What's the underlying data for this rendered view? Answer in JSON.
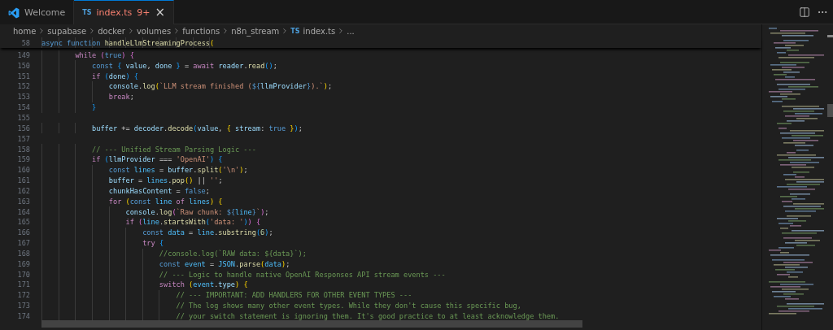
{
  "tabs": [
    {
      "kind": "welcome",
      "label": "Welcome",
      "selected": false
    },
    {
      "kind": "file",
      "file_icon": "TS",
      "label": "index.ts",
      "badge": "9+",
      "has_errors": true,
      "selected": true,
      "close": "×"
    }
  ],
  "breadcrumbs": [
    {
      "kind": "folder",
      "label": "home"
    },
    {
      "kind": "folder",
      "label": "supabase"
    },
    {
      "kind": "folder",
      "label": "docker"
    },
    {
      "kind": "folder",
      "label": "volumes"
    },
    {
      "kind": "folder",
      "label": "functions"
    },
    {
      "kind": "folder",
      "label": "n8n_stream"
    },
    {
      "kind": "file",
      "file_icon": "TS",
      "label": "index.ts"
    },
    {
      "kind": "more",
      "label": "..."
    }
  ],
  "sticky_line": {
    "number": "58",
    "code": [
      {
        "t": "async",
        "kind": "kw"
      },
      {
        "t": " function",
        "kind": "kw"
      },
      {
        "t": " handleLlmStreamingProcess",
        "kind": "fn"
      },
      {
        "t": "(",
        "kind": "b1"
      }
    ]
  },
  "lines": [
    {
      "number": "149",
      "code": [
        {
          "t": "        while",
          "kind": "ctl"
        },
        {
          "t": " (",
          "kind": "b2"
        },
        {
          "t": "true",
          "kind": "kw"
        },
        {
          "t": ")",
          "kind": "b2"
        },
        {
          "t": " {",
          "kind": "b2"
        }
      ]
    },
    {
      "number": "150",
      "code": [
        {
          "t": "            const",
          "kind": "kw"
        },
        {
          "t": " {",
          "kind": "b3"
        },
        {
          "t": " value",
          "kind": "var"
        },
        {
          "t": ", ",
          "kind": "p"
        },
        {
          "t": "done",
          "kind": "var"
        },
        {
          "t": " }",
          "kind": "b3"
        },
        {
          "t": " = ",
          "kind": "p"
        },
        {
          "t": "await",
          "kind": "ctl"
        },
        {
          "t": " reader",
          "kind": "var"
        },
        {
          "t": ".",
          "kind": "p"
        },
        {
          "t": "read",
          "kind": "fn"
        },
        {
          "t": "()",
          "kind": "b3"
        },
        {
          "t": ";",
          "kind": "p"
        }
      ]
    },
    {
      "number": "151",
      "code": [
        {
          "t": "            if",
          "kind": "ctl"
        },
        {
          "t": " (",
          "kind": "b3"
        },
        {
          "t": "done",
          "kind": "var"
        },
        {
          "t": ")",
          "kind": "b3"
        },
        {
          "t": " {",
          "kind": "b3"
        }
      ]
    },
    {
      "number": "152",
      "code": [
        {
          "t": "                console",
          "kind": "var"
        },
        {
          "t": ".",
          "kind": "p"
        },
        {
          "t": "log",
          "kind": "fn"
        },
        {
          "t": "(",
          "kind": "b1"
        },
        {
          "t": "`LLM stream finished (",
          "kind": "str"
        },
        {
          "t": "${",
          "kind": "kw"
        },
        {
          "t": "llmProvider",
          "kind": "var"
        },
        {
          "t": "}",
          "kind": "kw"
        },
        {
          "t": ").`",
          "kind": "str"
        },
        {
          "t": ")",
          "kind": "b1"
        },
        {
          "t": ";",
          "kind": "p"
        }
      ]
    },
    {
      "number": "153",
      "code": [
        {
          "t": "                break",
          "kind": "ctl"
        },
        {
          "t": ";",
          "kind": "p"
        }
      ]
    },
    {
      "number": "154",
      "code": [
        {
          "t": "            }",
          "kind": "b3"
        }
      ]
    },
    {
      "number": "155"
    },
    {
      "number": "156",
      "code": [
        {
          "t": "            buffer",
          "kind": "var"
        },
        {
          "t": " += ",
          "kind": "p"
        },
        {
          "t": "decoder",
          "kind": "var"
        },
        {
          "t": ".",
          "kind": "p"
        },
        {
          "t": "decode",
          "kind": "fn"
        },
        {
          "t": "(",
          "kind": "b3"
        },
        {
          "t": "value",
          "kind": "var"
        },
        {
          "t": ", ",
          "kind": "p"
        },
        {
          "t": "{",
          "kind": "b1"
        },
        {
          "t": " stream",
          "kind": "var"
        },
        {
          "t": ": ",
          "kind": "p"
        },
        {
          "t": "true",
          "kind": "kw"
        },
        {
          "t": " }",
          "kind": "b1"
        },
        {
          "t": ")",
          "kind": "b3"
        },
        {
          "t": ";",
          "kind": "p"
        }
      ]
    },
    {
      "number": "157"
    },
    {
      "number": "158",
      "code": [
        {
          "t": "            // --- Unified Stream Parsing Logic ---",
          "kind": "cmt"
        }
      ]
    },
    {
      "number": "159",
      "code": [
        {
          "t": "            if",
          "kind": "ctl"
        },
        {
          "t": " (",
          "kind": "b3"
        },
        {
          "t": "llmProvider",
          "kind": "var"
        },
        {
          "t": " === ",
          "kind": "p"
        },
        {
          "t": "'OpenAI'",
          "kind": "str"
        },
        {
          "t": ")",
          "kind": "b3"
        },
        {
          "t": " {",
          "kind": "b3"
        }
      ]
    },
    {
      "number": "160",
      "code": [
        {
          "t": "                const",
          "kind": "kw"
        },
        {
          "t": " lines",
          "kind": "const"
        },
        {
          "t": " = ",
          "kind": "p"
        },
        {
          "t": "buffer",
          "kind": "var"
        },
        {
          "t": ".",
          "kind": "p"
        },
        {
          "t": "split",
          "kind": "fn"
        },
        {
          "t": "(",
          "kind": "b1"
        },
        {
          "t": "'\\n'",
          "kind": "str"
        },
        {
          "t": ")",
          "kind": "b1"
        },
        {
          "t": ";",
          "kind": "p"
        }
      ]
    },
    {
      "number": "161",
      "code": [
        {
          "t": "                buffer",
          "kind": "var"
        },
        {
          "t": " = ",
          "kind": "p"
        },
        {
          "t": "lines",
          "kind": "const"
        },
        {
          "t": ".",
          "kind": "p"
        },
        {
          "t": "pop",
          "kind": "fn"
        },
        {
          "t": "()",
          "kind": "b1"
        },
        {
          "t": " || ",
          "kind": "p"
        },
        {
          "t": "''",
          "kind": "str"
        },
        {
          "t": ";",
          "kind": "p"
        }
      ]
    },
    {
      "number": "162",
      "code": [
        {
          "t": "                chunkHasContent",
          "kind": "var"
        },
        {
          "t": " = ",
          "kind": "p"
        },
        {
          "t": "false",
          "kind": "kw"
        },
        {
          "t": ";",
          "kind": "p"
        }
      ]
    },
    {
      "number": "163",
      "code": [
        {
          "t": "                for",
          "kind": "ctl"
        },
        {
          "t": " (",
          "kind": "b1"
        },
        {
          "t": "const",
          "kind": "kw"
        },
        {
          "t": " line",
          "kind": "const"
        },
        {
          "t": " of ",
          "kind": "ctl"
        },
        {
          "t": "lines",
          "kind": "const"
        },
        {
          "t": ")",
          "kind": "b1"
        },
        {
          "t": " {",
          "kind": "b1"
        }
      ]
    },
    {
      "number": "164",
      "code": [
        {
          "t": "                    console",
          "kind": "var"
        },
        {
          "t": ".",
          "kind": "p"
        },
        {
          "t": "log",
          "kind": "fn"
        },
        {
          "t": "(",
          "kind": "b2"
        },
        {
          "t": "`Raw chunk: ",
          "kind": "str"
        },
        {
          "t": "${",
          "kind": "kw"
        },
        {
          "t": "line",
          "kind": "const"
        },
        {
          "t": "}",
          "kind": "kw"
        },
        {
          "t": "`",
          "kind": "str"
        },
        {
          "t": ")",
          "kind": "b2"
        },
        {
          "t": ";",
          "kind": "p"
        }
      ]
    },
    {
      "number": "165",
      "code": [
        {
          "t": "                    if",
          "kind": "ctl"
        },
        {
          "t": " (",
          "kind": "b2"
        },
        {
          "t": "line",
          "kind": "const"
        },
        {
          "t": ".",
          "kind": "p"
        },
        {
          "t": "startsWith",
          "kind": "fn"
        },
        {
          "t": "(",
          "kind": "b3"
        },
        {
          "t": "'data: '",
          "kind": "str"
        },
        {
          "t": ")",
          "kind": "b3"
        },
        {
          "t": ")",
          "kind": "b2"
        },
        {
          "t": " {",
          "kind": "b2"
        }
      ]
    },
    {
      "number": "166",
      "code": [
        {
          "t": "                        const",
          "kind": "kw"
        },
        {
          "t": " data",
          "kind": "const"
        },
        {
          "t": " = ",
          "kind": "p"
        },
        {
          "t": "line",
          "kind": "const"
        },
        {
          "t": ".",
          "kind": "p"
        },
        {
          "t": "substring",
          "kind": "fn"
        },
        {
          "t": "(",
          "kind": "b3"
        },
        {
          "t": "6",
          "kind": "num"
        },
        {
          "t": ")",
          "kind": "b3"
        },
        {
          "t": ";",
          "kind": "p"
        }
      ]
    },
    {
      "number": "167",
      "code": [
        {
          "t": "                        try",
          "kind": "ctl"
        },
        {
          "t": " {",
          "kind": "b3"
        }
      ]
    },
    {
      "number": "168",
      "code": [
        {
          "t": "                            //console.log(`RAW data: ${data}`);",
          "kind": "cmt"
        }
      ]
    },
    {
      "number": "169",
      "code": [
        {
          "t": "                            const",
          "kind": "kw"
        },
        {
          "t": " event",
          "kind": "const"
        },
        {
          "t": " = ",
          "kind": "p"
        },
        {
          "t": "JSON",
          "kind": "const"
        },
        {
          "t": ".",
          "kind": "p"
        },
        {
          "t": "parse",
          "kind": "fn"
        },
        {
          "t": "(",
          "kind": "b1"
        },
        {
          "t": "data",
          "kind": "const"
        },
        {
          "t": ")",
          "kind": "b1"
        },
        {
          "t": ";",
          "kind": "p"
        }
      ]
    },
    {
      "number": "170",
      "code": [
        {
          "t": "                            // --- Logic to handle native OpenAI Responses API stream events ---",
          "kind": "cmt"
        }
      ]
    },
    {
      "number": "171",
      "code": [
        {
          "t": "                            switch",
          "kind": "ctl"
        },
        {
          "t": " (",
          "kind": "b1"
        },
        {
          "t": "event",
          "kind": "const"
        },
        {
          "t": ".",
          "kind": "p"
        },
        {
          "t": "type",
          "kind": "var"
        },
        {
          "t": ")",
          "kind": "b1"
        },
        {
          "t": " {",
          "kind": "b1"
        }
      ]
    },
    {
      "number": "172",
      "code": [
        {
          "t": "                                // --- IMPORTANT: ADD HANDLERS FOR OTHER EVENT TYPES ---",
          "kind": "cmt"
        }
      ]
    },
    {
      "number": "173",
      "code": [
        {
          "t": "                                // The log shows many other event types. While they don't cause this specific bug,",
          "kind": "cmt"
        }
      ]
    },
    {
      "number": "174",
      "code": [
        {
          "t": "                                // your switch statement is ignoring them. It's good practice to at least acknowledge them.",
          "kind": "cmt"
        }
      ]
    }
  ]
}
